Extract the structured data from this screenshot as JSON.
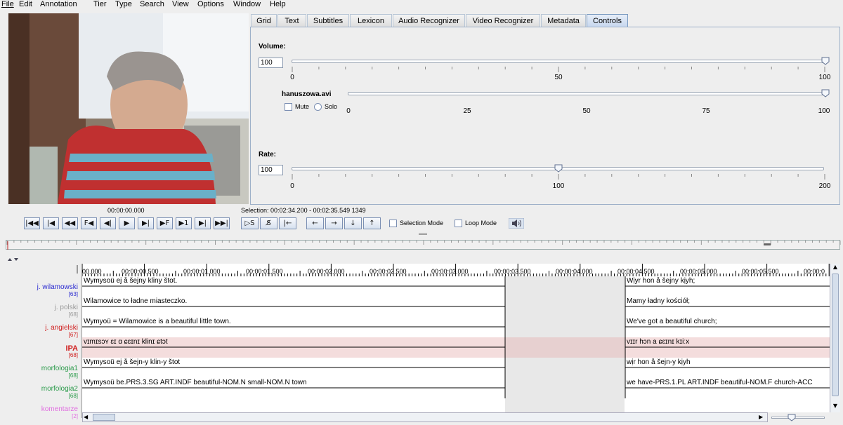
{
  "menu": [
    "File",
    "Edit",
    "Annotation",
    "Tier",
    "Type",
    "Search",
    "View",
    "Options",
    "Window",
    "Help"
  ],
  "tabs": [
    "Grid",
    "Text",
    "Subtitles",
    "Lexicon",
    "Audio Recognizer",
    "Video Recognizer",
    "Metadata",
    "Controls"
  ],
  "active_tab": "Controls",
  "controls": {
    "volume_label": "Volume:",
    "volume_value": "100",
    "volume_ticks": [
      "0",
      "50",
      "100"
    ],
    "volume_level": 100,
    "media_file": "hanuszowa.avi",
    "media_level": 100,
    "mute_label": "Mute",
    "solo_label": "Solo",
    "media_ticks": [
      "0",
      "25",
      "50",
      "75",
      "100"
    ],
    "rate_label": "Rate:",
    "rate_value": "100",
    "rate_ticks": [
      "0",
      "100",
      "200"
    ],
    "rate_level": 100
  },
  "player": {
    "time": "00:00:00.000",
    "selection": "Selection: 00:02:34.200 - 00:02:35.549  1349",
    "buttons_left": [
      "|◀◀",
      "|◀",
      "◀◀",
      "F◀",
      "◀|",
      "▶",
      "▶|",
      "▶F",
      "▶1",
      "▶|",
      "▶▶|"
    ],
    "buttons_sel": [
      "▷S",
      "S̸",
      "|←"
    ],
    "buttons_nav": [
      "←",
      "→",
      "↓",
      "↑"
    ],
    "selection_mode": "Selection Mode",
    "loop_mode": "Loop Mode"
  },
  "ruler": [
    "00.000",
    "00:00:00.500",
    "00:00:01.000",
    "00:00:01.500",
    "00:00:02.000",
    "00:00:02.500",
    "00:00:03.000",
    "00:00:03.500",
    "00:00:04.000",
    "00:00:04.500",
    "00:00:05.000",
    "00:00:05.500",
    "00:00:0"
  ],
  "tiers": [
    {
      "name": "j. wilamowski",
      "count": "[63]",
      "color": "#2b2bd0",
      "ann1": "Wymysoü ej å šejny kliny štot.",
      "ann2": "Wịyr hon å šejny kịyh;",
      "bg": "#f0f0f0"
    },
    {
      "name": "j. polski",
      "count": "[68]",
      "color": "#9a9a9a",
      "ann1": "Wilamowice to ładne miasteczko.",
      "ann2": "Mamy ładny kościół;",
      "bg": "#ffffff"
    },
    {
      "name": "j. angielski",
      "count": "[67]",
      "color": "#d02020",
      "ann1": "Wymyoü = Wilamowice is a beautiful little town.",
      "ann2": "We've got a beautiful church;",
      "bg": "#f0f0f0"
    },
    {
      "name": "IPA",
      "count": "[68]",
      "color": "#d02020",
      "ann1": "vɪmɪsɔʏ ɛɪ ɑ ɕɛɪnɪ klinɪ ɕtɔt",
      "ann2": "vɪɪr hɔn a ɕɛɪnɪ kɪiːx",
      "bg": "#f4dede"
    },
    {
      "name": "morfologia1",
      "count": "[68]",
      "color": "#2a9a4a",
      "ann1": "Wymysoü ej å šejn-y klin-y štot",
      "ann2": "wịr hon å šejn-y kịyh",
      "bg": "#f0f0f0"
    },
    {
      "name": "morfologia2",
      "count": "[68]",
      "color": "#2a9a4a",
      "ann1": "Wymysoü be.PRS.3.SG  ART.INDF beautiful-NOM.N small-NOM.N town",
      "ann2": "we have-PRS.1.PL ART.INDF beautiful-NOM.F church-ACC",
      "bg": "#ffffff"
    },
    {
      "name": "komentarze",
      "count": "[2]",
      "color": "#e070e0",
      "ann1": "",
      "ann2": "",
      "bg": "#f0f0f0"
    }
  ]
}
